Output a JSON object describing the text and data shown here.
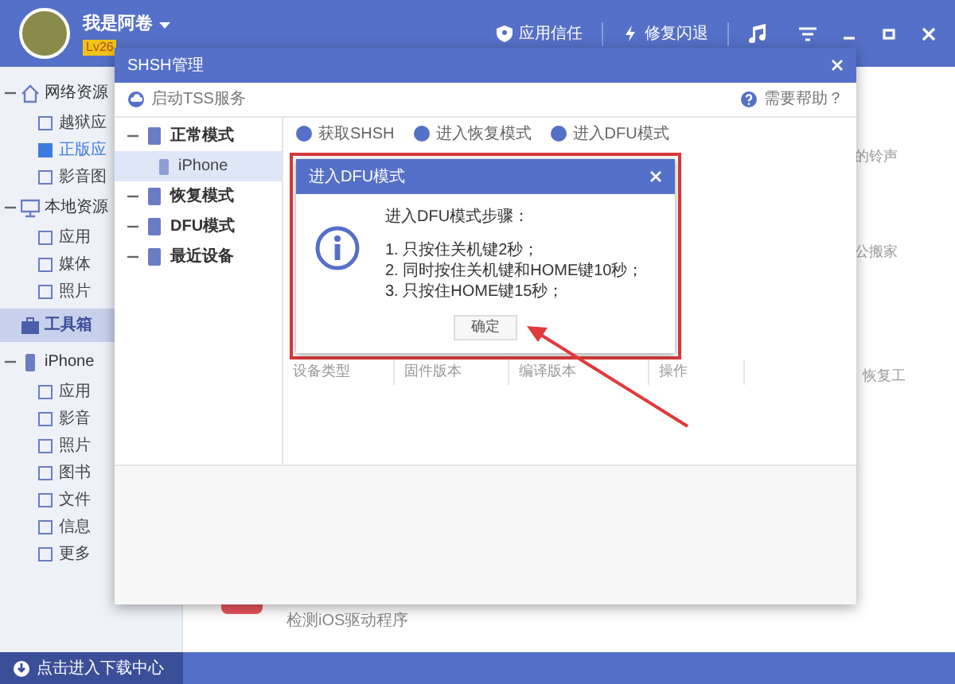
{
  "app": {
    "user_name": "我是阿卷",
    "level_badge": "Lv26",
    "top_actions": [
      {
        "label": "应用信任"
      },
      {
        "label": "修复闪退"
      }
    ]
  },
  "sidebar": {
    "sections": [
      {
        "label": "网络资源",
        "kind": "group",
        "expanded": true,
        "selected": false,
        "items": [
          {
            "label": "越狱应",
            "selected": false
          },
          {
            "label": "正版应",
            "selected": true
          },
          {
            "label": "影音图",
            "selected": false
          }
        ]
      },
      {
        "label": "本地资源",
        "kind": "group",
        "expanded": true,
        "selected": false,
        "items": [
          {
            "label": "应用",
            "selected": false
          },
          {
            "label": "媒体",
            "selected": false
          },
          {
            "label": "照片",
            "selected": false
          }
        ]
      },
      {
        "label": "工具箱",
        "kind": "link",
        "selected": true
      },
      {
        "label": "iPhone",
        "kind": "group",
        "expanded": true,
        "selected": false,
        "items": [
          {
            "label": "应用",
            "selected": false
          },
          {
            "label": "影音",
            "selected": false
          },
          {
            "label": "照片",
            "selected": false
          },
          {
            "label": "图书",
            "selected": false
          },
          {
            "label": "文件",
            "selected": false
          },
          {
            "label": "信息",
            "selected": false
          },
          {
            "label": "更多",
            "selected": false
          }
        ]
      }
    ],
    "download_center": "点击进入下载中心"
  },
  "background": {
    "snippets": [
      "的铃声",
      "公搬家",
      "恢复工"
    ],
    "driver_check": "检测iOS驱动程序"
  },
  "shsh_dialog": {
    "title": "SHSH管理",
    "tss_button": "启动TSS服务",
    "help_link": "需要帮助？",
    "tree": [
      {
        "label": "正常模式",
        "expanded": true,
        "children": [
          {
            "label": "iPhone",
            "selected": true
          }
        ]
      },
      {
        "label": "恢复模式",
        "expanded": true
      },
      {
        "label": "DFU模式",
        "expanded": true
      },
      {
        "label": "最近设备",
        "expanded": true
      }
    ],
    "toolbar": [
      "获取SHSH",
      "进入恢复模式",
      "进入DFU模式"
    ],
    "columns": [
      "设备类型",
      "固件版本",
      "编译版本",
      "操作"
    ]
  },
  "dfu_dialog": {
    "title": "进入DFU模式",
    "heading": "进入DFU模式步骤：",
    "steps": [
      "1. 只按住关机键2秒；",
      "2. 同时按住关机键和HOME键10秒；",
      "3. 只按住HOME键15秒；"
    ],
    "ok_button": "确定"
  }
}
